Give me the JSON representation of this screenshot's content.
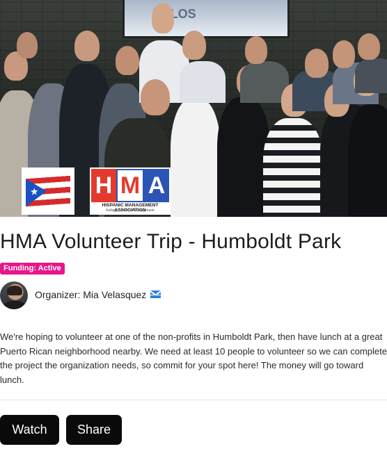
{
  "campaign": {
    "title": "HMA Volunteer Trip - Humboldt Park",
    "funding_badge": "Funding: Active",
    "organizer_text": "Organizer: Mia Velasquez",
    "description": "We're hoping to volunteer at one of the non-profits in Humboldt Park, then have lunch at a great Puerto Rican neighborhood nearby. We need at least 10 people to volunteer so we can complete the project the organization needs, so commit for your spot here! The money will go toward lunch."
  },
  "hero": {
    "logo": {
      "letters": [
        "H",
        "M",
        "A"
      ],
      "org_name": "HISPANIC MANAGEMENT ASSOCIATION",
      "school": "Kellogg School of Management"
    },
    "screen_text": "TOLOS"
  },
  "actions": {
    "watch_label": "Watch",
    "share_label": "Share"
  },
  "colors": {
    "badge": "#e8168a",
    "button": "#0a0a0a",
    "mail_icon": "#2f7fd8"
  },
  "icons": {
    "organizer_contact": "mail-icon"
  }
}
